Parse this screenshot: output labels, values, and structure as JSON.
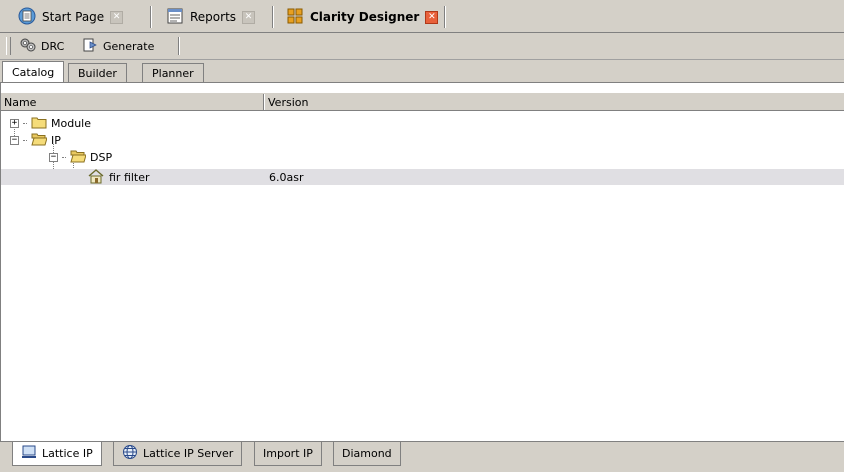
{
  "doc_tabs": [
    {
      "label": "Start Page",
      "icon": "start-page-icon",
      "active": false
    },
    {
      "label": "Reports",
      "icon": "reports-icon",
      "active": false
    },
    {
      "label": "Clarity Designer",
      "icon": "clarity-designer-icon",
      "active": true
    }
  ],
  "toolbar": {
    "drc_label": "DRC",
    "generate_label": "Generate"
  },
  "view_tabs": [
    "Catalog",
    "Builder",
    "Planner"
  ],
  "table": {
    "columns": [
      "Name",
      "Version"
    ],
    "rows": [
      {
        "name": "Module",
        "version": "",
        "level": 0,
        "expander": "+",
        "icon": "folder-closed-icon"
      },
      {
        "name": "IP",
        "version": "",
        "level": 0,
        "expander": "-",
        "icon": "folder-open-icon"
      },
      {
        "name": "DSP",
        "version": "",
        "level": 1,
        "expander": "-",
        "icon": "folder-open-icon"
      },
      {
        "name": "fir filter",
        "version": "6.0asr",
        "level": 2,
        "expander": "",
        "icon": "ip-house-icon",
        "selected": true
      }
    ]
  },
  "bottom_tabs": [
    {
      "label": "Lattice IP",
      "icon": "monitor-icon",
      "active": true
    },
    {
      "label": "Lattice IP Server",
      "icon": "globe-icon",
      "active": false
    },
    {
      "label": "Import IP",
      "active": false
    },
    {
      "label": "Diamond",
      "active": false
    }
  ],
  "colors": {
    "chrome": "#d4d0c8",
    "active_close": "#e8603a",
    "selected_row": "#e0dfe3"
  }
}
